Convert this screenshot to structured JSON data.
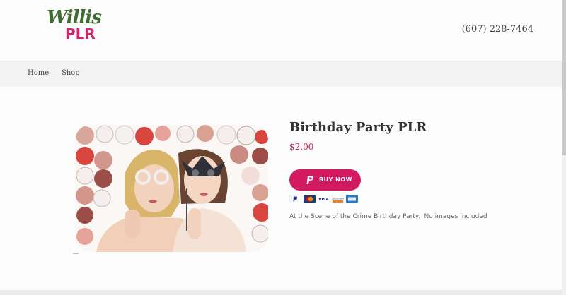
{
  "brand": {
    "logo_top": "Willis",
    "logo_bottom": "PLR"
  },
  "header": {
    "phone": "(607) 228-7464"
  },
  "nav": {
    "items": [
      {
        "label": "Home"
      },
      {
        "label": "Shop"
      }
    ]
  },
  "product": {
    "title": "Birthday Party PLR",
    "price": "$2.00",
    "buy_label": "BUY NOW",
    "description": "At the Scene of the Crime Birthday Party.  No images included",
    "cards": [
      "paypal-icon",
      "mastercard-icon",
      "visa-icon",
      "discover-icon",
      "amex-icon"
    ]
  },
  "colors": {
    "accent": "#d3195f",
    "price": "#c2185b",
    "logo_green": "#3e6b2f",
    "logo_pink": "#d5246a"
  }
}
